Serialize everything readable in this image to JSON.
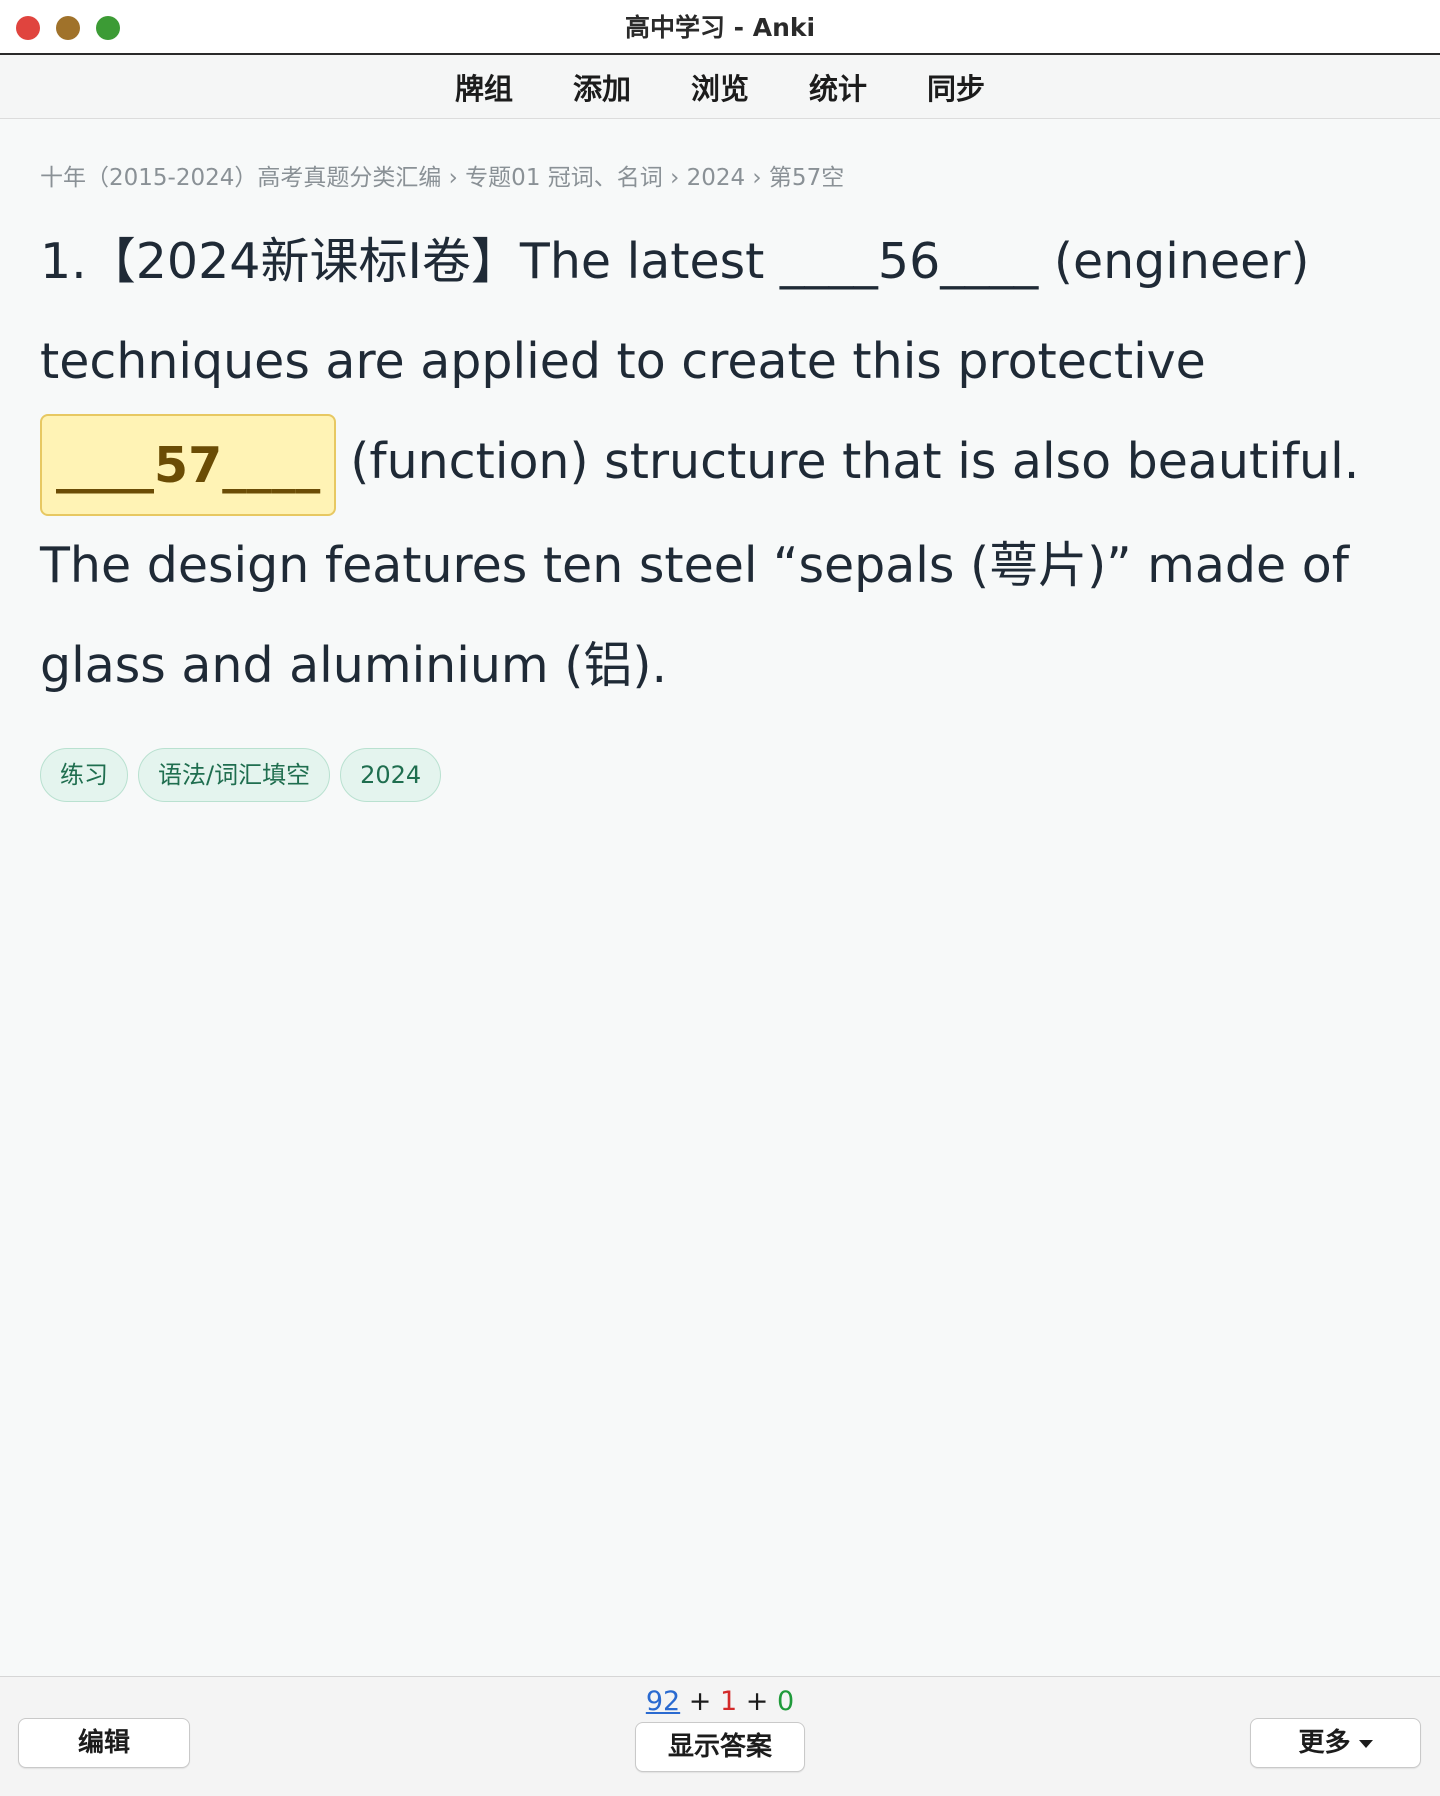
{
  "window": {
    "title": "高中学习 - Anki"
  },
  "topnav": {
    "items": [
      "牌组",
      "添加",
      "浏览",
      "统计",
      "同步"
    ]
  },
  "card": {
    "breadcrumb": "十年（2015-2024）高考真题分类汇编 › 专题01 冠词、名词 › 2024 › 第57空",
    "question": {
      "part1": "1.【2024新课标I卷】The latest ____56____ (engineer) techniques are applied to create this protective ",
      "active_blank": "____57____",
      "part2": "(function) structure that is also beautiful. The design features ten steel “sepals (萼片)” made of glass and aluminium (铝)."
    },
    "tags": [
      "练习",
      "语法/词汇填空",
      "2024"
    ]
  },
  "bottombar": {
    "counts": {
      "new": "92",
      "sep1": "+",
      "learn": "1",
      "sep2": "+",
      "review": "0"
    },
    "edit_label": "编辑",
    "show_answer_label": "显示答案",
    "more_label": "更多"
  },
  "colors": {
    "new_count": "#2a6ad0",
    "learn_count": "#d32a2a",
    "review_count": "#1f9a3a",
    "cloze_highlight": "#fff3b5",
    "tag_background": "#e4f4ee"
  }
}
